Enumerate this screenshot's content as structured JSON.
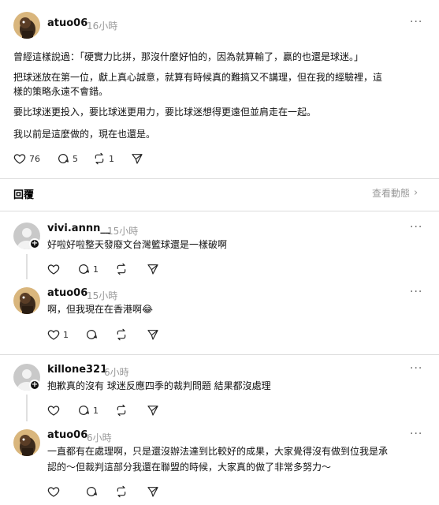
{
  "post": {
    "username": "atuo06",
    "time": "16小時",
    "paragraphs": [
      "曾經這樣說過：「硬實力比拼，那沒什麼好怕的，因為就算輸了，贏的也還是球迷。」",
      "把球迷放在第一位，獻上真心誠意，就算有時候真的難搞又不講理，但在我的經驗裡，這",
      "樣的策略永遠不會錯。",
      "要比球迷更投入，要比球迷更用力，要比球迷想得更遠但並肩走在一起。",
      "我以前是這麼做的，現在也還是。"
    ],
    "likes": "76",
    "comments": "5",
    "reposts": "1"
  },
  "replies_bar": {
    "label": "回覆",
    "view_activity": "查看動態"
  },
  "replies": [
    {
      "username": "vivi.annn__",
      "time": "15小時",
      "lines": [
        "好啦好啦整天發廢文台灣籃球還是一樣破啊"
      ],
      "likes": "",
      "comments": "1",
      "reposts": ""
    },
    {
      "username": "atuo06",
      "time": "15小時",
      "lines": [
        "啊，但我現在在香港啊😂"
      ],
      "likes": "1",
      "comments": "",
      "reposts": ""
    },
    {
      "username": "killone321",
      "time": "6小時",
      "lines": [
        "抱歉真的沒有 球迷反應四季的裁判問題 結果都沒處理"
      ],
      "likes": "",
      "comments": "1",
      "reposts": ""
    },
    {
      "username": "atuo06",
      "time": "6小時",
      "lines": [
        "一直都有在處理啊，只是還沒辦法達到比較好的成果，大家覺得沒有做到位我是承",
        "認的～但裁判這部分我還在聯盟的時候，大家真的做了非常多努力～"
      ],
      "likes": "",
      "comments": "",
      "reposts": ""
    }
  ],
  "icons": {
    "like": "heart-icon",
    "comment": "comment-bubble-icon",
    "repost": "repost-icon",
    "share": "send-icon",
    "more": "more-icon",
    "chevron": "chevron-right-icon",
    "follow": "plus-icon"
  }
}
